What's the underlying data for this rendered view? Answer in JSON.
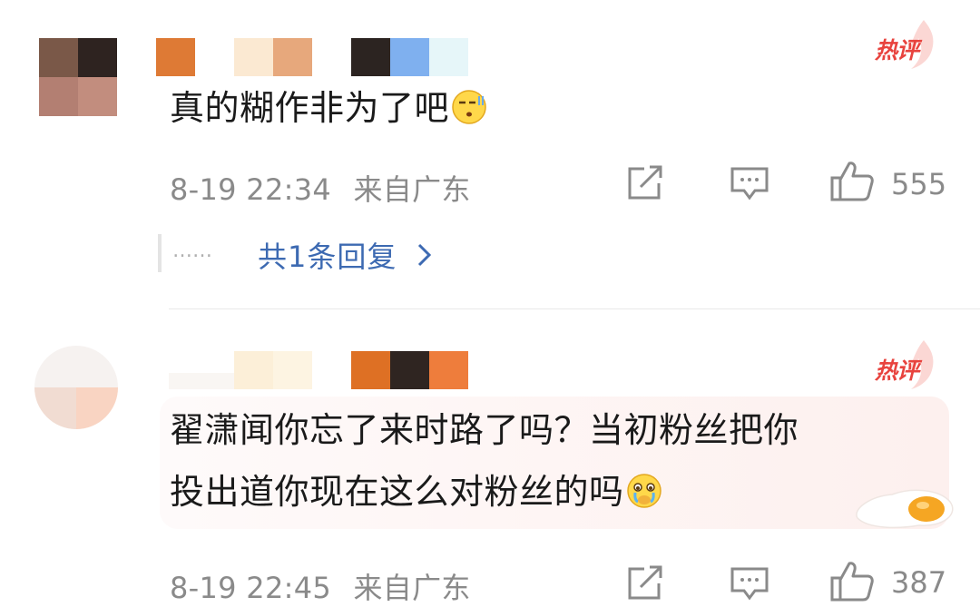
{
  "comments": [
    {
      "hot_label": "热评",
      "text": "真的糊作非为了吧",
      "emoji": "grimace-emoji",
      "date": "8-19 22:34",
      "location": "来自广东",
      "like_count": "555",
      "replies": {
        "dots": "……",
        "label": "共1条回复"
      }
    },
    {
      "hot_label": "热评",
      "text_line1": "翟潇闻你忘了来时路了吗？当初粉丝把你",
      "text_line2": "投出道你现在这么对粉丝的吗",
      "emoji": "crying-emoji",
      "date": "8-19 22:45",
      "location": "来自广东",
      "like_count": "387"
    }
  ],
  "colors": {
    "hot_red": "#e8433e",
    "link_blue": "#3d6ab2",
    "meta_gray": "#8a8a8a",
    "icon_gray": "#8a8a8a",
    "highlight_bg": "#fdf0ee"
  },
  "icons": [
    "share-icon",
    "comment-icon",
    "like-icon",
    "chevron-right-icon"
  ]
}
